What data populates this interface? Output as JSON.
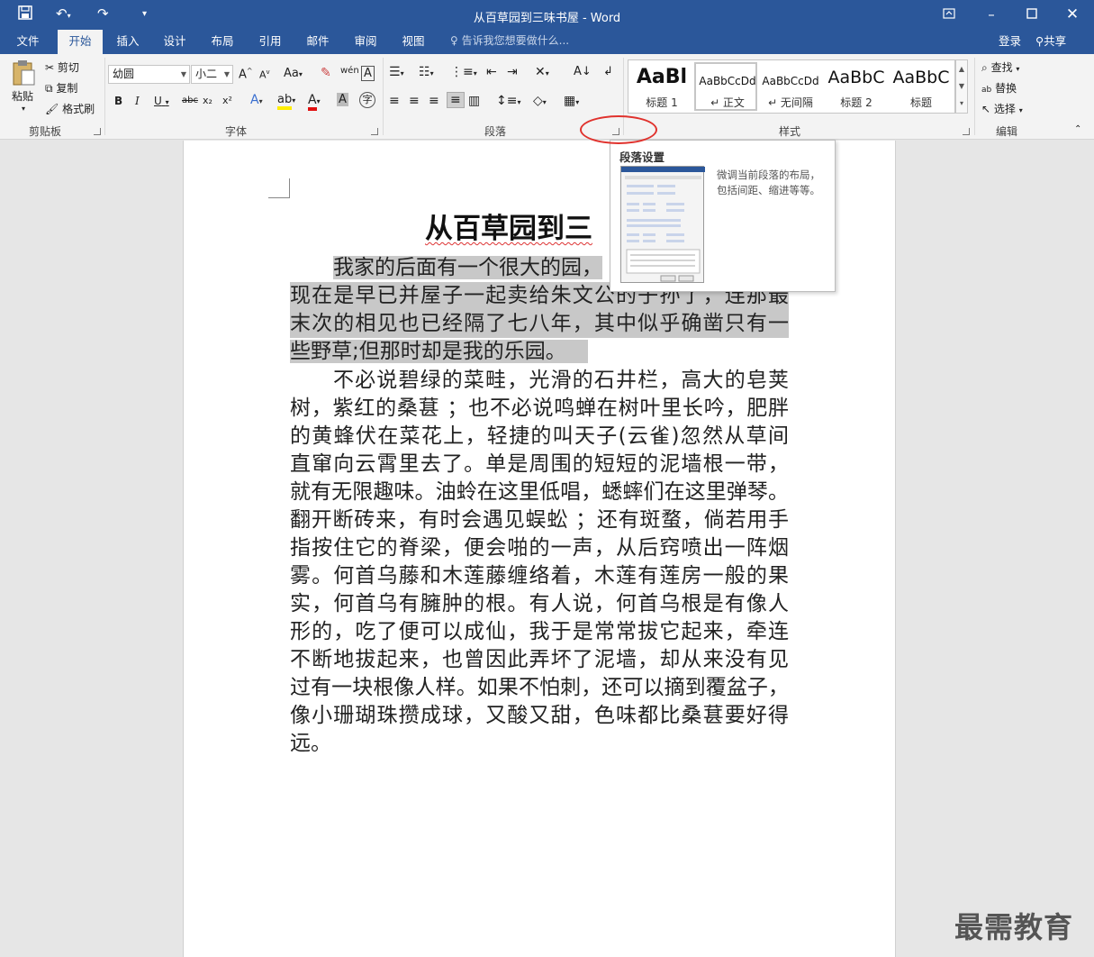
{
  "window": {
    "title": "从百草园到三味书屋 - Word",
    "quick_access": {
      "save_icon": "save-icon",
      "undo_icon": "undo-icon",
      "redo_icon": "redo-icon",
      "customize_icon": "customize-icon"
    },
    "controls": {
      "ribbon_display": "ribbon-display-icon",
      "minimize": "minimize-icon",
      "maximize": "maximize-icon",
      "close": "close-icon"
    }
  },
  "tabs": [
    {
      "label": "文件"
    },
    {
      "label": "开始"
    },
    {
      "label": "插入"
    },
    {
      "label": "设计"
    },
    {
      "label": "布局"
    },
    {
      "label": "引用"
    },
    {
      "label": "邮件"
    },
    {
      "label": "审阅"
    },
    {
      "label": "视图"
    }
  ],
  "tell_me": "告诉我您想要做什么...",
  "login": "登录",
  "share": "共享",
  "ribbon": {
    "clipboard": {
      "paste": "粘贴",
      "cut": "剪切",
      "copy": "复制",
      "format_painter": "格式刷",
      "group_label": "剪贴板"
    },
    "font": {
      "font_name": "幼圆",
      "font_size": "小二",
      "group_label": "字体",
      "bold": "B",
      "italic": "I",
      "underline": "U",
      "strike": "abc",
      "sub": "x₂",
      "sup": "x²",
      "grow": "A",
      "shrink": "A",
      "case": "Aa",
      "phonetic": "wén",
      "border_char": "A",
      "enclose": "字"
    },
    "paragraph": {
      "group_label": "段落"
    },
    "styles": {
      "group_label": "样式",
      "items": [
        {
          "sample": "AaBl",
          "name": "标题 1"
        },
        {
          "sample": "AaBbCcDd",
          "name": "↵ 正文"
        },
        {
          "sample": "AaBbCcDd",
          "name": "↵ 无间隔"
        },
        {
          "sample": "AaBbC",
          "name": "标题 2"
        },
        {
          "sample": "AaBbC",
          "name": "标题"
        }
      ]
    },
    "editing": {
      "find": "查找",
      "replace": "替换",
      "select": "选择",
      "group_label": "编辑"
    }
  },
  "tooltip": {
    "title": "段落设置",
    "description": "微调当前段落的布局，包括间距、缩进等等。"
  },
  "document": {
    "title": "从百草园到三",
    "para1": [
      "我家的后面有一个很大的园，",
      "现在是早已并屋子一起卖给朱文公的子孙了，连那最",
      "末次的相见也已经隔了七八年，其中似乎确凿只有一",
      "些野草;但那时却是我的乐园。"
    ],
    "para2": [
      "不必说碧绿的菜畦，光滑的石井栏，高大的皂荚",
      "树，紫红的桑葚 ；也不必说鸣蝉在树叶里长吟，肥胖",
      "的黄蜂伏在菜花上，轻捷的叫天子(云雀)忽然从草间",
      "直窜向云霄里去了。单是周围的短短的泥墙根一带，",
      "就有无限趣味。油蛉在这里低唱，蟋蟀们在这里弹琴。",
      "翻开断砖来，有时会遇见蜈蚣 ；还有斑蝥，倘若用手",
      "指按住它的脊梁，便会啪的一声，从后窍喷出一阵烟",
      "雾。何首乌藤和木莲藤缠络着，木莲有莲房一般的果",
      "实，何首乌有臃肿的根。有人说，何首乌根是有像人",
      "形的，吃了便可以成仙，我于是常常拔它起来，牵连",
      "不断地拔起来，也曾因此弄坏了泥墙，却从来没有见",
      "过有一块根像人样。如果不怕刺，还可以摘到覆盆子，",
      "像小珊瑚珠攒成球，又酸又甜，色味都比桑葚要好得",
      "远。"
    ]
  },
  "watermark": "最需教育",
  "colors": {
    "titlebar": "#2b579a",
    "ribbon": "#f3f3f3",
    "highlight": "#c8c8c8",
    "annotation": "#e0322d"
  }
}
